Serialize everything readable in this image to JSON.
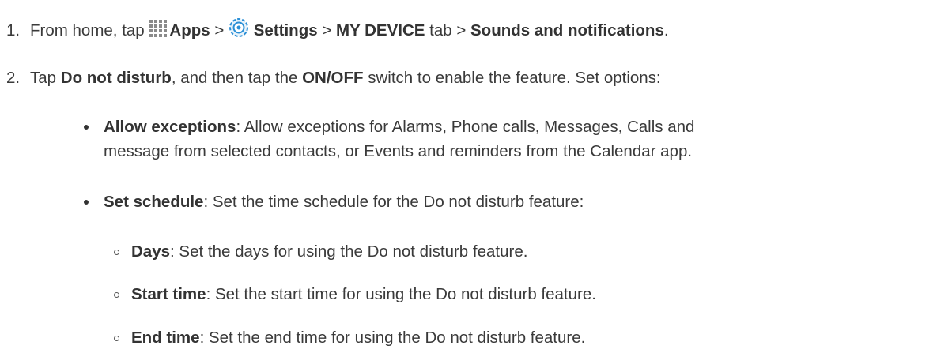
{
  "step1": {
    "number": "1.",
    "prefix": "From home, tap",
    "apps": "Apps",
    "sep1": ">",
    "settings": "Settings",
    "sep2": ">",
    "tab": "MY DEVICE",
    "tab_suffix": "tab >",
    "target": "Sounds and notifications",
    "end": "."
  },
  "step2": {
    "number": "2.",
    "tap": "Tap",
    "feature": "Do not disturb",
    "mid": ", and then tap the",
    "switch": "ON/OFF",
    "rest": "switch to enable the feature. Set options:"
  },
  "bullets": {
    "allow": {
      "term": "Allow exceptions",
      "desc1": ": Allow exceptions for Alarms, Phone calls, Messages, Calls and",
      "desc2": "message from selected contacts, or Events and reminders from the Calendar app."
    },
    "schedule": {
      "term": "Set schedule",
      "desc": ": Set the time schedule for the Do not disturb feature:"
    }
  },
  "sub_bullets": {
    "days": {
      "term": "Days",
      "desc": ": Set the days for using the Do not disturb feature."
    },
    "start": {
      "term": "Start time",
      "desc": ": Set the start time for using the Do not disturb feature."
    },
    "end": {
      "term": "End time",
      "desc": ": Set the end time for using the Do not disturb feature."
    }
  },
  "icons": {
    "apps": "apps-grid-icon",
    "settings": "settings-gear-icon",
    "accent": "#2a8fd6"
  }
}
